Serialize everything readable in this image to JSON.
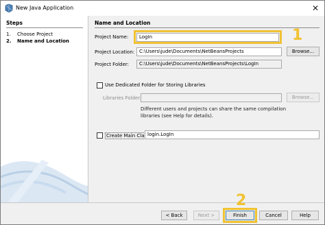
{
  "window": {
    "title": "New Java Application",
    "close_glyph": "✕",
    "icon": "java-app-icon"
  },
  "steps": {
    "title": "Steps",
    "items": [
      {
        "num": "1.",
        "label": "Choose Project"
      },
      {
        "num": "2.",
        "label": "Name and Location"
      }
    ]
  },
  "form": {
    "section_title": "Name and Location",
    "project_name_label": "Project Name:",
    "project_name_value": "LogIn",
    "project_location_label": "Project Location:",
    "project_location_value": "C:\\Users\\jude\\Documents\\NetBeansProjects",
    "browse_label": "Browse...",
    "project_folder_label": "Project Folder:",
    "project_folder_value": "C:\\Users\\jude\\Documents\\NetBeansProjects\\LogIn",
    "dedicated_folder_label": "Use Dedicated Folder for Storing Libraries",
    "libraries_folder_label": "Libraries Folder:",
    "libraries_browse_label": "Browse...",
    "help_text_line1": "Different users and projects can share the same compilation",
    "help_text_line2": "libraries (see Help for details).",
    "create_main_class_label": "Create Main Class",
    "main_class_value": "login.LogIn"
  },
  "buttons": {
    "back": "< Back",
    "next": "Next >",
    "finish": "Finish",
    "cancel": "Cancel",
    "help": "Help"
  },
  "annotations": {
    "callout_1": "1",
    "callout_2": "2",
    "highlight_color": "#f1c232"
  }
}
